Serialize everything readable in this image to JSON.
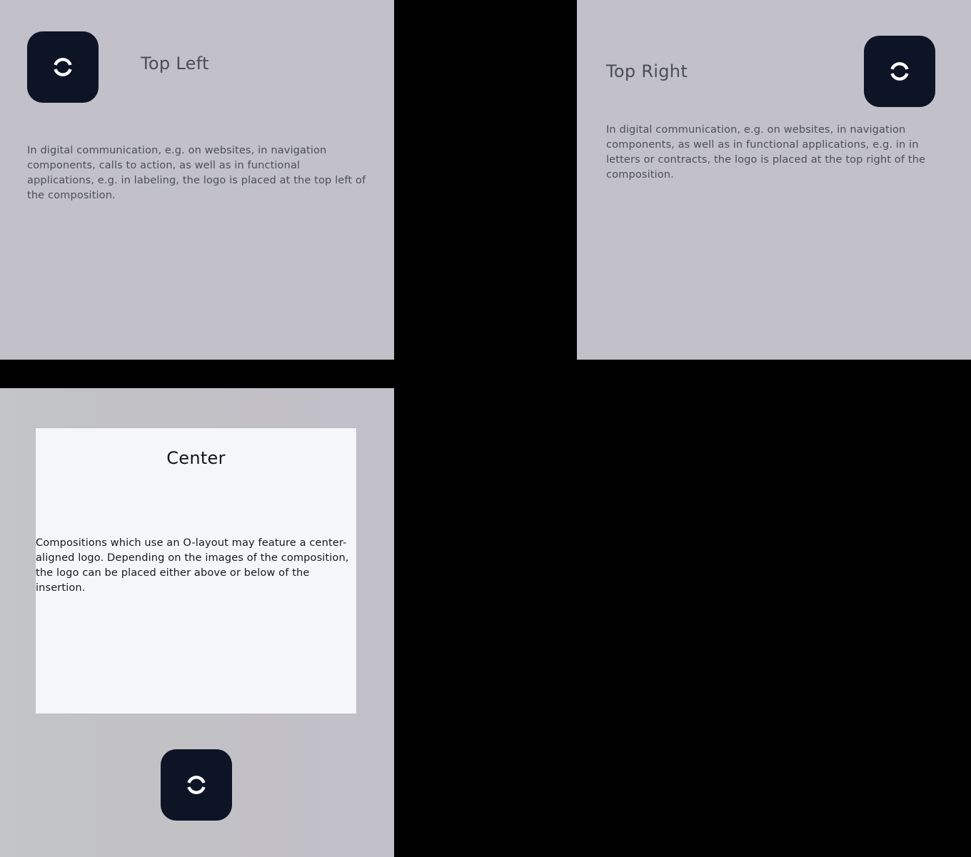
{
  "panels": {
    "top_left": {
      "title": "Top Left",
      "text": "In digital communication, e.g. on websites, in navigation components, calls to action, as well as in functional applications, e.g. in labeling, the logo is placed at the top left of the composition.",
      "logo_icon": "ring-logo-icon"
    },
    "top_right": {
      "title": "Top Right",
      "text": "In digital communication, e.g. on websites, in navigation components, as well as in functional applications, e.g. in in letters or contracts, the logo is placed at the top right of the composition.",
      "logo_icon": "ring-logo-icon"
    },
    "center": {
      "title": "Center",
      "text": "Compositions which use an O-layout may feature a center-aligned logo. Depending on the images of the composition, the logo can be placed either above or below of the insertion.",
      "logo_icon": "ring-logo-icon"
    }
  },
  "colors": {
    "page_background": "#000000",
    "panel_background": "#c2c1c9",
    "card_background": "#f5f6f8",
    "logo_tile": "#0c1426",
    "logo_mark": "#ffffff"
  }
}
